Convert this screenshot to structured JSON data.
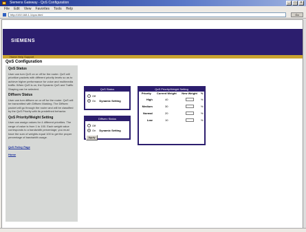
{
  "browser": {
    "title": "Siemens Gateway - QoS Configuration",
    "menu": [
      "File",
      "Edit",
      "View",
      "Favorites",
      "Tools",
      "Help"
    ],
    "address": "http://192.168.1.1/qos.html",
    "go_label": "Go"
  },
  "header": {
    "brand": "SIEMENS",
    "nav": "Home  Help  Support"
  },
  "page": {
    "title": "QoS Configuration"
  },
  "sidebar": {
    "sections": [
      {
        "heading": "QoS Status",
        "text": "User can turn QoS on or off for the router. QoS will prioritize packets with different priority levels so as to achieve higher performance for voice and multimedia traffic. When QoS is on, the Dynamic QoS and Traffic Shaping can be selected."
      },
      {
        "heading": "Diffserv Status",
        "text": "User can turn diffserv on or off for the router. QoS will be transmitted with Diffserv Marking. The Diffserv packet will go through the router and will be classified by the QoS Priority with its predefined behavior."
      },
      {
        "heading": "QoS Priority/Weight Setting",
        "text": "User can assign values for 4 different priorities. The range of value is from 1 to 100. Each weight value corresponds to a bandwidth percentage; you must have the sum of weights equal 100 to get the proper percentage of bandwidth usage."
      }
    ],
    "link_policy": "QoS Policy Page",
    "link_home": "Home"
  },
  "qos_status": {
    "title": "QoS Status",
    "off_label": "Off",
    "on_label": "On",
    "extra": "Dynamic Setting",
    "selected": "On"
  },
  "diffserv_status": {
    "title": "Diffserv Status",
    "off_label": "Off",
    "on_label": "On",
    "extra": "Dynamic Setting",
    "selected": "On"
  },
  "priority": {
    "title": "QoS Priority/Weight Setting",
    "col_priority": "Priority",
    "col_current": "Current Weight",
    "col_new": "New Weight",
    "col_pct": "%",
    "rows": [
      {
        "label": "High",
        "current": "40",
        "pct": "%"
      },
      {
        "label": "Medium",
        "current": "30",
        "pct": "%"
      },
      {
        "label": "Normal",
        "current": "20",
        "pct": "%"
      },
      {
        "label": "Low",
        "current": "10",
        "pct": "%"
      }
    ]
  },
  "apply_label": "Apply"
}
